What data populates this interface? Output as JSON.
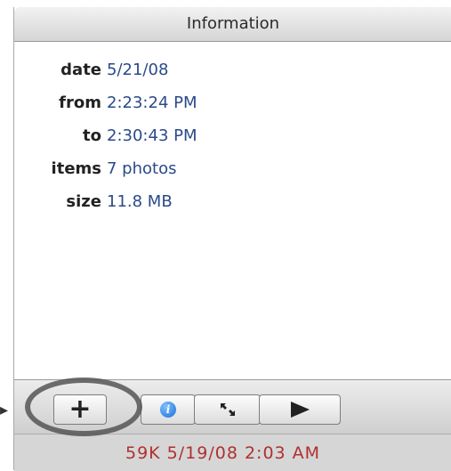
{
  "panel": {
    "title": "Information"
  },
  "info": [
    {
      "label": "date",
      "value": "5/21/08"
    },
    {
      "label": "from",
      "value": "2:23:24 PM"
    },
    {
      "label": "to",
      "value": "2:30:43 PM"
    },
    {
      "label": "items",
      "value": "7 photos"
    },
    {
      "label": "size",
      "value": "11.8 MB"
    }
  ],
  "toolbar": {
    "add_icon": "plus-icon",
    "info_icon": "info-icon",
    "fullscreen_icon": "fullscreen-icon",
    "play_icon": "play-icon"
  },
  "status": {
    "text": "59K  5/19/08  2:03 AM"
  },
  "colors": {
    "status_text": "#b03030",
    "value_text": "#2a4a8a",
    "ring": "#555555"
  }
}
